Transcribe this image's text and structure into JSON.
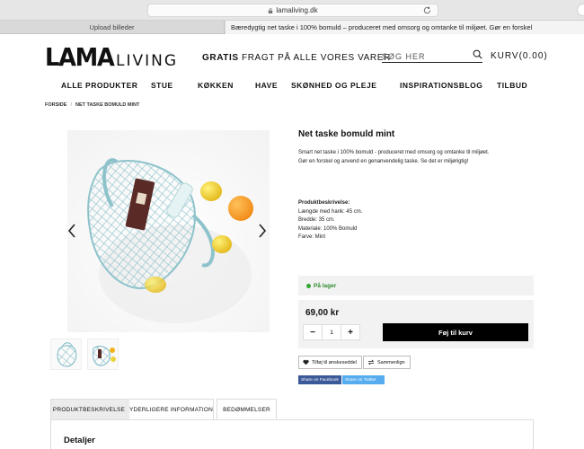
{
  "browser": {
    "url": "lamaliving.dk",
    "tabs": [
      {
        "label": "Upload billeder"
      },
      {
        "label": "Bæredygtig net taske i 100% bomuld – produceret med omsorg og omtanke til miljøet. Gør en forskel"
      }
    ]
  },
  "header": {
    "logo_main": "LAMA",
    "logo_sub": "LIVING",
    "freight_bold": "GRATIS",
    "freight_rest": "FRAGT PÅ ALLE VORES VARER",
    "search_placeholder": "SØG HER",
    "cart_label": "KURV(0.00)"
  },
  "nav": {
    "items": [
      {
        "label": "ALLE PRODUKTER"
      },
      {
        "label": "STUE"
      },
      {
        "label": "KØKKEN"
      },
      {
        "label": "HAVE"
      },
      {
        "label": "SKØNHED OG PLEJE"
      },
      {
        "label": "INSPIRATIONSBLOG"
      },
      {
        "label": "TILBUD"
      }
    ]
  },
  "breadcrumb": [
    "FORSIDE",
    "NET TASKE BOMULD MINT"
  ],
  "product": {
    "title": "Net taske bomuld mint",
    "description": [
      "Smart net taske i 100% bomuld - produceret med omsorg og omtanke til miljøet.",
      "Gør en forskel og anvend en genanvendelig taske. Se det er miljørigtig!"
    ],
    "details_heading": "Produktbeskrivelse:",
    "details": [
      "Længde med hank: 45 cm.",
      "Bredde: 35 cm.",
      "Materiale: 100% Bomuld",
      "Farve: Mint"
    ],
    "stock_label": "På lager",
    "price": "69,00 kr",
    "quantity": "1",
    "add_to_cart": "Føj til kurv",
    "wishlist": "Tilføj til ønskeseddel",
    "compare": "Sammenlign",
    "share_facebook": "Share on Facebook",
    "share_twitter": "Share on Twitter"
  },
  "product_tabs": [
    {
      "label": "PRODUKTBESKRIVELSE",
      "active": true
    },
    {
      "label": "YDERLIGERE INFORMATION",
      "active": false
    },
    {
      "label": "BEDØMMELSER",
      "active": false
    }
  ],
  "tab_panel_title": "Detaljer",
  "colors": {
    "accent": "#000000",
    "stock_green": "#2ea62e",
    "facebook": "#3b5998",
    "twitter": "#55acee",
    "bag_mint": "#8fc3cc"
  }
}
